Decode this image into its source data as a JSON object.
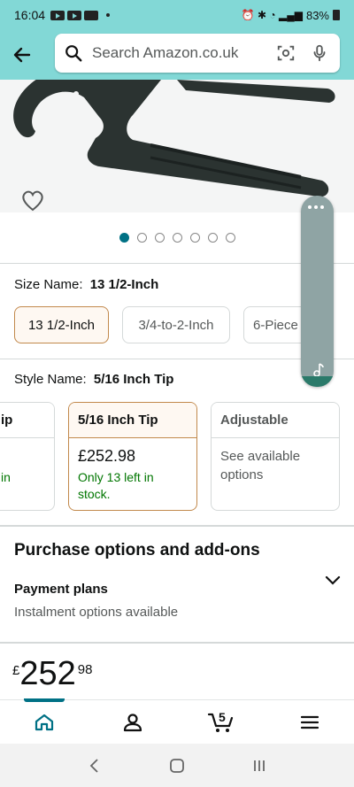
{
  "status_bar": {
    "time": "16:04",
    "battery": "83%"
  },
  "search": {
    "placeholder": "Search Amazon.co.uk"
  },
  "product": {
    "carousel_count": 7,
    "carousel_active": 0
  },
  "size": {
    "label": "Size Name:",
    "value": "13 1/2-Inch",
    "options": [
      {
        "label": "13 1/2-Inch",
        "selected": true
      },
      {
        "label": "3/4-to-2-Inch",
        "selected": false
      },
      {
        "label": "6-Piece",
        "selected": false
      }
    ]
  },
  "style": {
    "label": "Style Name:",
    "value": "5/16 Inch Tip",
    "cards": [
      {
        "title": "ip",
        "line1": "",
        "line2": "in"
      },
      {
        "title": "5/16 Inch Tip",
        "price": "£252.98",
        "stock": "Only 13 left in stock."
      },
      {
        "title": "Adjustable",
        "note": "See available options"
      }
    ]
  },
  "purchase": {
    "title": "Purchase options and add-ons",
    "payment_title": "Payment plans",
    "payment_sub": "Instalment options available"
  },
  "price": {
    "currency": "£",
    "whole": "252",
    "fraction": "98"
  },
  "bottom_nav": {
    "cart_count": "5",
    "items": [
      "home",
      "account",
      "cart",
      "menu"
    ]
  },
  "colors": {
    "header": "#82d8d6",
    "accent": "#007185",
    "selected_border": "#c2894c",
    "in_stock": "#007600"
  }
}
